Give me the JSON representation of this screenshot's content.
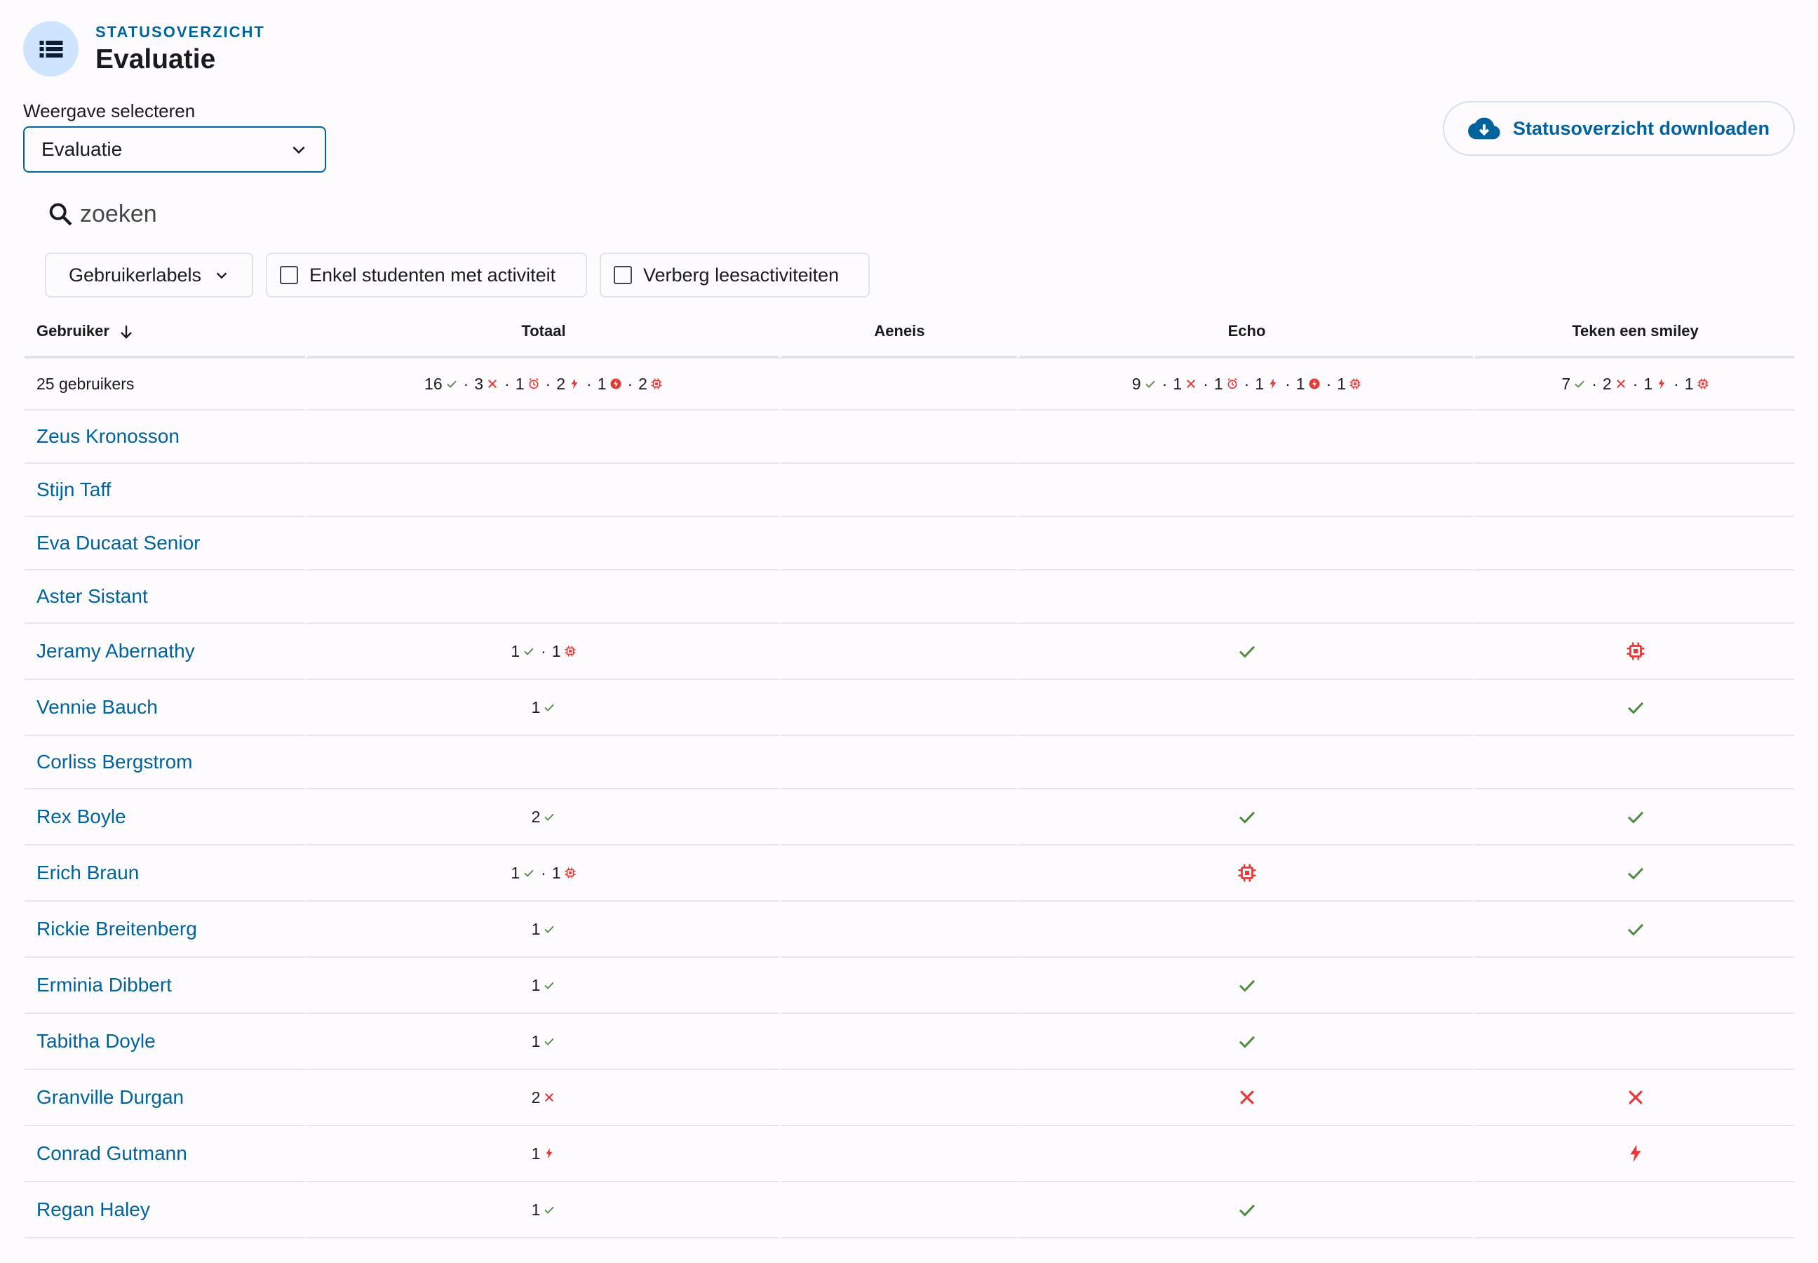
{
  "header": {
    "eyebrow": "STATUSOVERZICHT",
    "title": "Evaluatie",
    "icon": "list-icon"
  },
  "view_select": {
    "label": "Weergave selecteren",
    "value": "Evaluatie"
  },
  "download_button": {
    "label": "Statusoverzicht downloaden",
    "icon": "cloud-download-icon"
  },
  "search": {
    "placeholder": "zoeken"
  },
  "filters": {
    "labels": "Gebruikerlabels",
    "only_active": "Enkel studenten met activiteit",
    "hide_reading": "Verberg leesactiviteiten"
  },
  "table": {
    "columns": [
      "Gebruiker",
      "Totaal",
      "Aeneis",
      "Echo",
      "Teken een smiley"
    ],
    "summary": {
      "label": "25 gebruikers",
      "totaal": [
        [
          "16",
          "correct"
        ],
        [
          "3",
          "wrong"
        ],
        [
          "1",
          "time-limit"
        ],
        [
          "2",
          "runtime-error"
        ],
        [
          "1",
          "compilation-error"
        ],
        [
          "2",
          "memory-limit"
        ]
      ],
      "aeneis": [],
      "echo": [
        [
          "9",
          "correct"
        ],
        [
          "1",
          "wrong"
        ],
        [
          "1",
          "time-limit"
        ],
        [
          "1",
          "runtime-error"
        ],
        [
          "1",
          "compilation-error"
        ],
        [
          "1",
          "memory-limit"
        ]
      ],
      "smiley": [
        [
          "7",
          "correct"
        ],
        [
          "2",
          "wrong"
        ],
        [
          "1",
          "runtime-error"
        ],
        [
          "1",
          "memory-limit"
        ]
      ]
    },
    "rows": [
      {
        "name": "Zeus Kronosson",
        "totaal": [],
        "aeneis": "",
        "echo": "",
        "smiley": ""
      },
      {
        "name": "Stijn Taff",
        "totaal": [],
        "aeneis": "",
        "echo": "",
        "smiley": ""
      },
      {
        "name": "Eva Ducaat Senior",
        "totaal": [],
        "aeneis": "",
        "echo": "",
        "smiley": ""
      },
      {
        "name": "Aster Sistant",
        "totaal": [],
        "aeneis": "",
        "echo": "",
        "smiley": ""
      },
      {
        "name": "Jeramy Abernathy",
        "totaal": [
          [
            "1",
            "correct"
          ],
          [
            "1",
            "memory-limit"
          ]
        ],
        "aeneis": "",
        "echo": "correct",
        "smiley": "memory-limit"
      },
      {
        "name": "Vennie Bauch",
        "totaal": [
          [
            "1",
            "correct"
          ]
        ],
        "aeneis": "",
        "echo": "",
        "smiley": "correct"
      },
      {
        "name": "Corliss Bergstrom",
        "totaal": [],
        "aeneis": "",
        "echo": "",
        "smiley": ""
      },
      {
        "name": "Rex Boyle",
        "totaal": [
          [
            "2",
            "correct"
          ]
        ],
        "aeneis": "",
        "echo": "correct",
        "smiley": "correct"
      },
      {
        "name": "Erich Braun",
        "totaal": [
          [
            "1",
            "correct"
          ],
          [
            "1",
            "memory-limit"
          ]
        ],
        "aeneis": "",
        "echo": "memory-limit",
        "smiley": "correct"
      },
      {
        "name": "Rickie Breitenberg",
        "totaal": [
          [
            "1",
            "correct"
          ]
        ],
        "aeneis": "",
        "echo": "",
        "smiley": "correct"
      },
      {
        "name": "Erminia Dibbert",
        "totaal": [
          [
            "1",
            "correct"
          ]
        ],
        "aeneis": "",
        "echo": "correct",
        "smiley": ""
      },
      {
        "name": "Tabitha Doyle",
        "totaal": [
          [
            "1",
            "correct"
          ]
        ],
        "aeneis": "",
        "echo": "correct",
        "smiley": ""
      },
      {
        "name": "Granville Durgan",
        "totaal": [
          [
            "2",
            "wrong"
          ]
        ],
        "aeneis": "",
        "echo": "wrong",
        "smiley": "wrong"
      },
      {
        "name": "Conrad Gutmann",
        "totaal": [
          [
            "1",
            "runtime-error"
          ]
        ],
        "aeneis": "",
        "echo": "",
        "smiley": "runtime-error"
      },
      {
        "name": "Regan Haley",
        "totaal": [
          [
            "1",
            "correct"
          ]
        ],
        "aeneis": "",
        "echo": "correct",
        "smiley": ""
      }
    ]
  },
  "colors": {
    "accent": "#00639b",
    "correct": "#4f8a3c",
    "error": "#e53935",
    "icon_bg": "#cfe5ff"
  }
}
